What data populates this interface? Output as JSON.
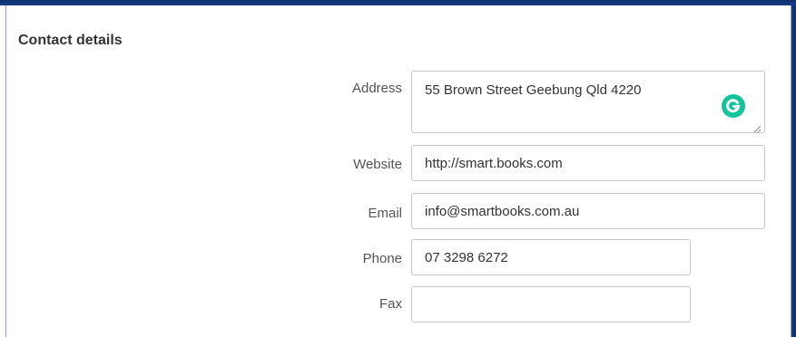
{
  "section": {
    "title": "Contact details"
  },
  "fields": {
    "address": {
      "label": "Address",
      "value": "55 Brown Street Geebung Qld 4220"
    },
    "website": {
      "label": "Website",
      "value": "http://smart.books.com"
    },
    "email": {
      "label": "Email",
      "value": "info@smartbooks.com.au"
    },
    "phone": {
      "label": "Phone",
      "value": "07 3298 6272"
    },
    "fax": {
      "label": "Fax",
      "value": ""
    }
  },
  "icons": {
    "grammarly": "grammarly-icon",
    "resize": "resize-grip-icon"
  },
  "colors": {
    "frame": "#0c2f6b",
    "grammarly": "#15c39a",
    "label": "#555555",
    "title": "#333333",
    "input_border": "#c8c8c8"
  }
}
